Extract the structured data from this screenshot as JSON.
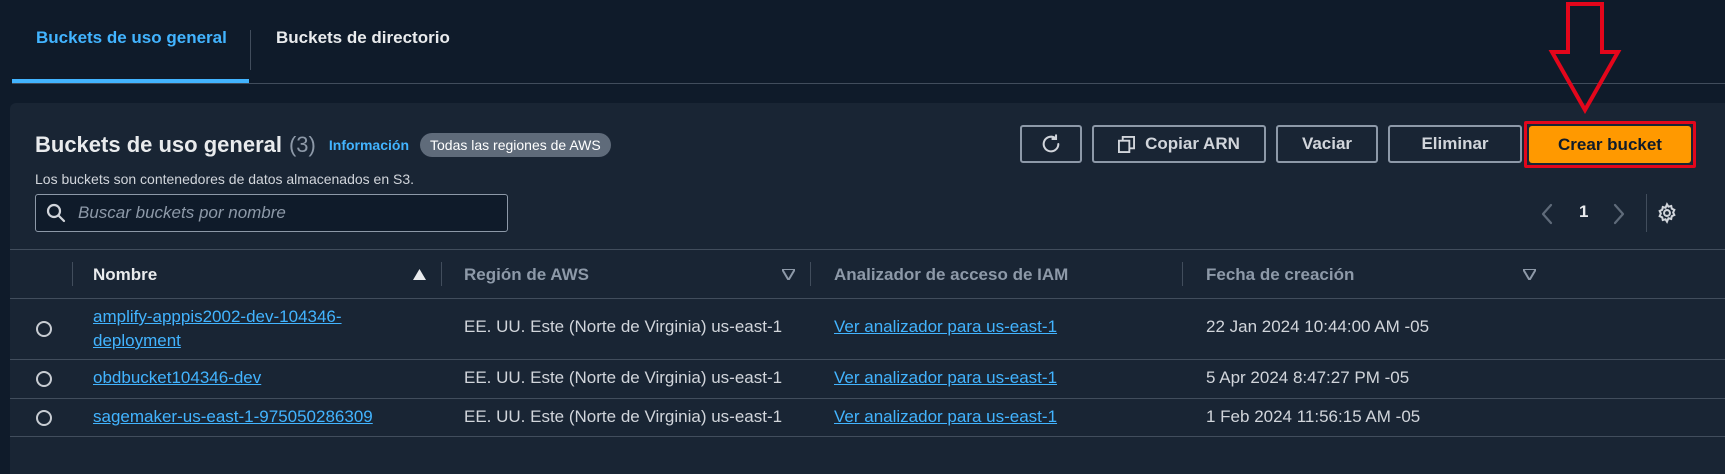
{
  "tabs": [
    {
      "label": "Buckets de uso general"
    },
    {
      "label": "Buckets de directorio"
    }
  ],
  "header": {
    "title": "Buckets de uso general",
    "count": "(3)",
    "info_link": "Información",
    "region_badge": "Todas las regiones de AWS",
    "subtitle": "Los buckets son contenedores de datos almacenados en S3."
  },
  "toolbar": {
    "copy_arn": "Copiar ARN",
    "empty": "Vaciar",
    "delete": "Eliminar",
    "create": "Crear bucket"
  },
  "search": {
    "placeholder": "Buscar buckets por nombre",
    "value": ""
  },
  "pagination": {
    "current_page": "1"
  },
  "table": {
    "columns": [
      "Nombre",
      "Región de AWS",
      "Analizador de acceso de IAM",
      "Fecha de creación"
    ],
    "rows": [
      {
        "name": "amplify-apppis2002-dev-104346-\ndeployment",
        "region": "EE. UU. Este (Norte de Virginia) us-east-1",
        "analyzer": "Ver analizador para us-east-1",
        "created": "22 Jan 2024 10:44:00 AM -05"
      },
      {
        "name": "obdbucket104346-dev",
        "region": "EE. UU. Este (Norte de Virginia) us-east-1",
        "analyzer": "Ver analizador para us-east-1",
        "created": "5 Apr 2024 8:47:27 PM -05"
      },
      {
        "name": "sagemaker-us-east-1-975050286309",
        "region": "EE. UU. Este (Norte de Virginia) us-east-1",
        "analyzer": "Ver analizador para us-east-1",
        "created": "1 Feb 2024 11:56:15 AM -05"
      }
    ]
  },
  "colors": {
    "accent": "#42b4ff",
    "primary_button": "#ff9900",
    "highlight": "#e3061b",
    "background": "#0f1b2a",
    "panel": "#192534"
  },
  "icons": [
    "refresh-icon",
    "copy-icon",
    "search-icon",
    "chevron-left-icon",
    "chevron-right-icon",
    "gear-icon",
    "sort-up-icon",
    "sort-down-icon",
    "red-arrow-annotation"
  ]
}
